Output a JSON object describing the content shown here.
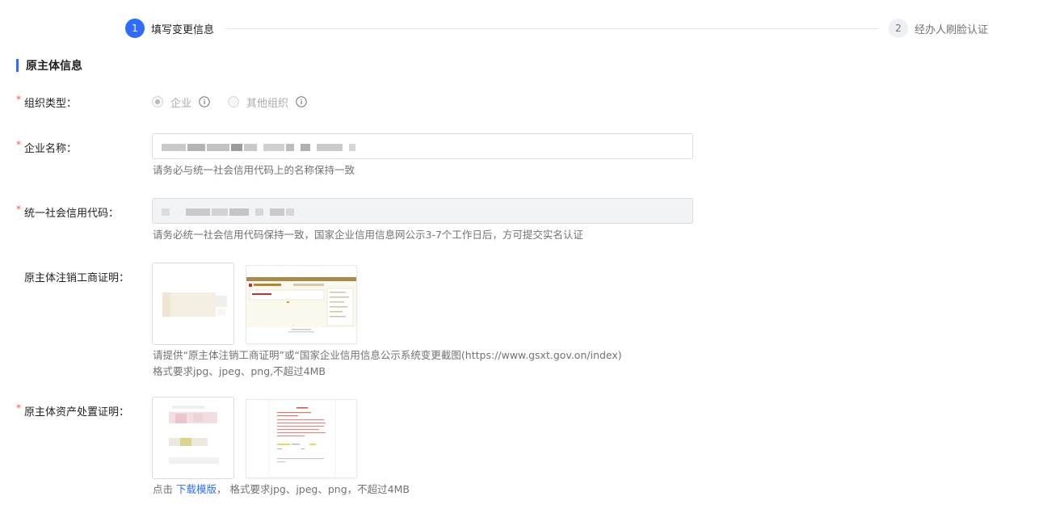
{
  "steps": [
    {
      "number": "1",
      "label": "填写变更信息",
      "active": true
    },
    {
      "number": "2",
      "label": "经办人刷脸认证",
      "active": false
    }
  ],
  "section": {
    "title": "原主体信息"
  },
  "colors": {
    "accent": "#2f6bff",
    "required": "#f25454",
    "hint": "#6f7276",
    "link": "#2f6bff"
  },
  "form": {
    "org_type": {
      "label": "组织类型：",
      "required": true,
      "options": [
        {
          "label": "企业",
          "checked": true,
          "icon": "info-icon"
        },
        {
          "label": "其他组织",
          "checked": false,
          "icon": "info-icon"
        }
      ]
    },
    "company_name": {
      "label": "企业名称：",
      "required": true,
      "hint": "请务必与统一社会信用代码上的名称保持一致"
    },
    "credit_code": {
      "label": "统一社会信用代码：",
      "required": true,
      "disabled": true,
      "hint": "请务必统一社会信用代码保持一致，国家企业信用信息网公示3-7个工作日后，方可提交实名认证"
    },
    "cancel_proof": {
      "label": "原主体注销工商证明：",
      "required": false,
      "hint_line1": "请提供“原主体注销工商证明”或“国家企业信用信息公示系统变更截图(https://www.gsxt.gov.on/index)",
      "hint_line2": "格式要求jpg、jpeg、png,不超过4MB"
    },
    "asset_proof": {
      "label": "原主体资产处置证明：",
      "required": true,
      "hint_prefix": "点击",
      "hint_link": "下载模版",
      "hint_suffix": "，  格式要求jpg、jpeg、png，不超过4MB"
    }
  }
}
